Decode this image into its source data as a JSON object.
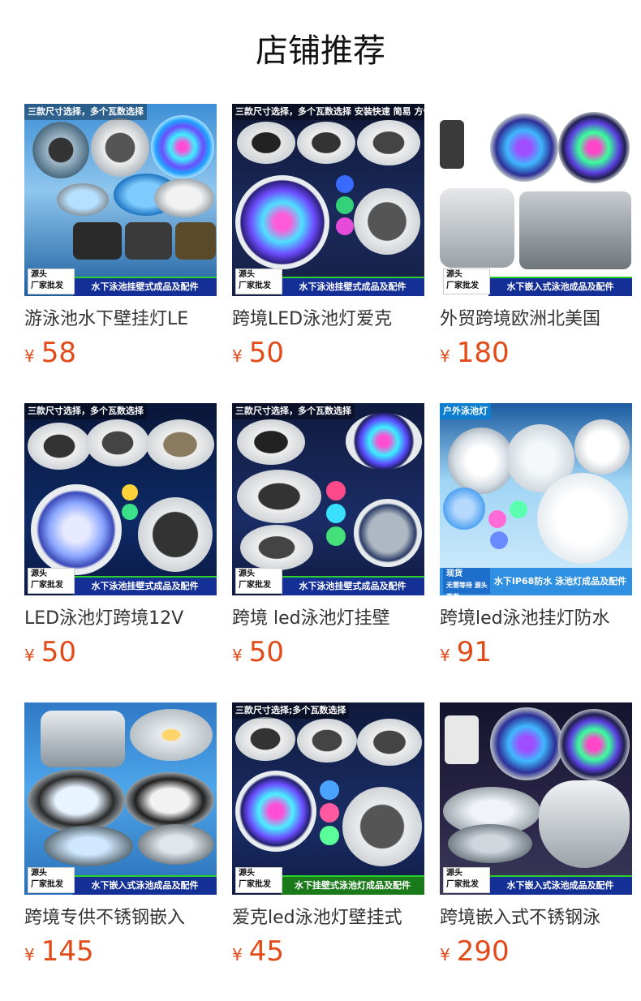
{
  "header": {
    "title": "店铺推荐"
  },
  "currency_symbol": "¥",
  "products": [
    {
      "title": "游泳池水下壁挂灯LE",
      "price": "58",
      "banner": "三款尺寸选择，多个瓦数选择",
      "strip": "水下泳池挂壁式成品及配件",
      "source_1": "源头",
      "source_2": "厂家批发"
    },
    {
      "title": "跨境LED泳池灯爱克",
      "price": "50",
      "banner": "三款尺寸选择，多个瓦数选择 安装快速 简易 方便",
      "strip": "水下泳池挂壁式成品及配件",
      "source_1": "源头",
      "source_2": "厂家批发"
    },
    {
      "title": "外贸跨境欧洲北美国",
      "price": "180",
      "banner": "",
      "strip": "水下嵌入式泳池成品及配件",
      "source_1": "源头",
      "source_2": "厂家批发"
    },
    {
      "title": "LED泳池灯跨境12V",
      "price": "50",
      "banner": "三款尺寸选择，多个瓦数选择",
      "strip": "水下泳池挂壁式成品及配件",
      "source_1": "源头",
      "source_2": "厂家批发"
    },
    {
      "title": "跨境 led泳池灯挂壁",
      "price": "50",
      "banner": "三款尺寸选择，多个瓦数选择",
      "strip": "水下泳池挂壁式成品及配件",
      "source_1": "源头",
      "source_2": "厂家批发"
    },
    {
      "title": "跨境led泳池挂灯防水",
      "price": "91",
      "banner": "户外泳池灯",
      "strip": "水下IP68防水 泳池灯成品及配件",
      "source_1": "现货",
      "source_2": "无需等待 源头直发"
    },
    {
      "title": "跨境专供不锈钢嵌入",
      "price": "145",
      "banner": "",
      "strip": "水下嵌入式泳池成品及配件",
      "source_1": "源头",
      "source_2": "厂家批发"
    },
    {
      "title": "爱克led泳池灯壁挂式",
      "price": "45",
      "banner": "三款尺寸选择;多个瓦数选择",
      "strip": "水下挂壁式泳池灯成品及配件",
      "source_1": "源头",
      "source_2": "厂家批发"
    },
    {
      "title": "跨境嵌入式不锈钢泳",
      "price": "290",
      "banner": "",
      "strip": "水下嵌入式泳池成品及配件",
      "source_1": "源头",
      "source_2": "厂家批发"
    }
  ]
}
